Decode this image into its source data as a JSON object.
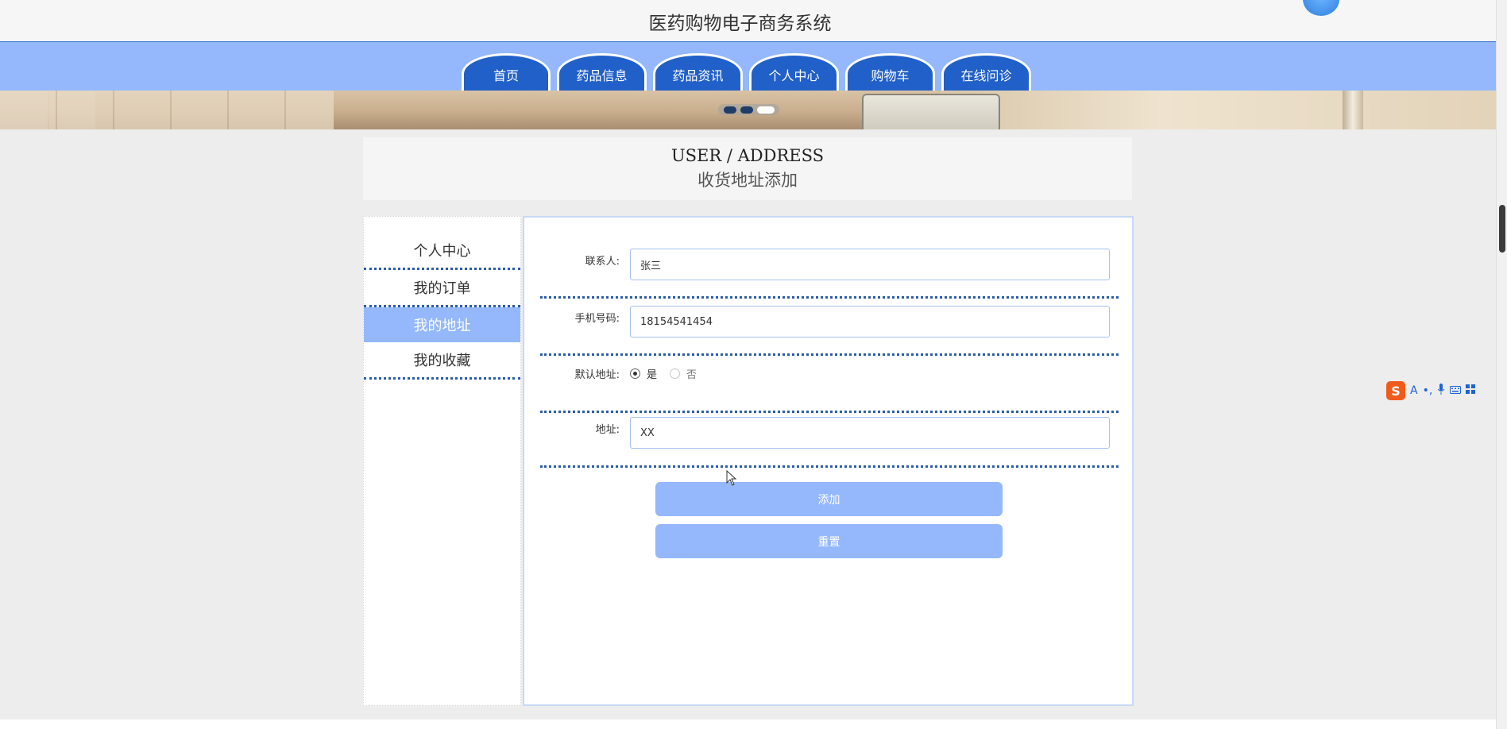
{
  "header": {
    "site_title": "医药购物电子商务系统"
  },
  "nav": {
    "items": [
      {
        "label": "首页"
      },
      {
        "label": "药品信息"
      },
      {
        "label": "药品资讯"
      },
      {
        "label": "个人中心"
      },
      {
        "label": "购物车"
      },
      {
        "label": "在线问诊"
      }
    ]
  },
  "banner": {
    "slides": 3,
    "active_slide": 3
  },
  "page_title": {
    "en": "USER / ADDRESS",
    "cn": "收货地址添加"
  },
  "sidebar": {
    "items": [
      {
        "label": "个人中心",
        "active": false
      },
      {
        "label": "我的订单",
        "active": false
      },
      {
        "label": "我的地址",
        "active": true
      },
      {
        "label": "我的收藏",
        "active": false
      }
    ]
  },
  "form": {
    "contact": {
      "label": "联系人:",
      "value": "张三"
    },
    "phone": {
      "label": "手机号码:",
      "value": "18154541454"
    },
    "default": {
      "label": "默认地址:",
      "options": [
        "是",
        "否"
      ],
      "selected": "是"
    },
    "address": {
      "label": "地址:",
      "value": "XX"
    },
    "add_label": "添加",
    "reset_label": "重置"
  },
  "ime": {
    "logo": "S",
    "icons": [
      "A",
      "•,",
      "mic",
      "keyboard",
      "grid"
    ]
  }
}
